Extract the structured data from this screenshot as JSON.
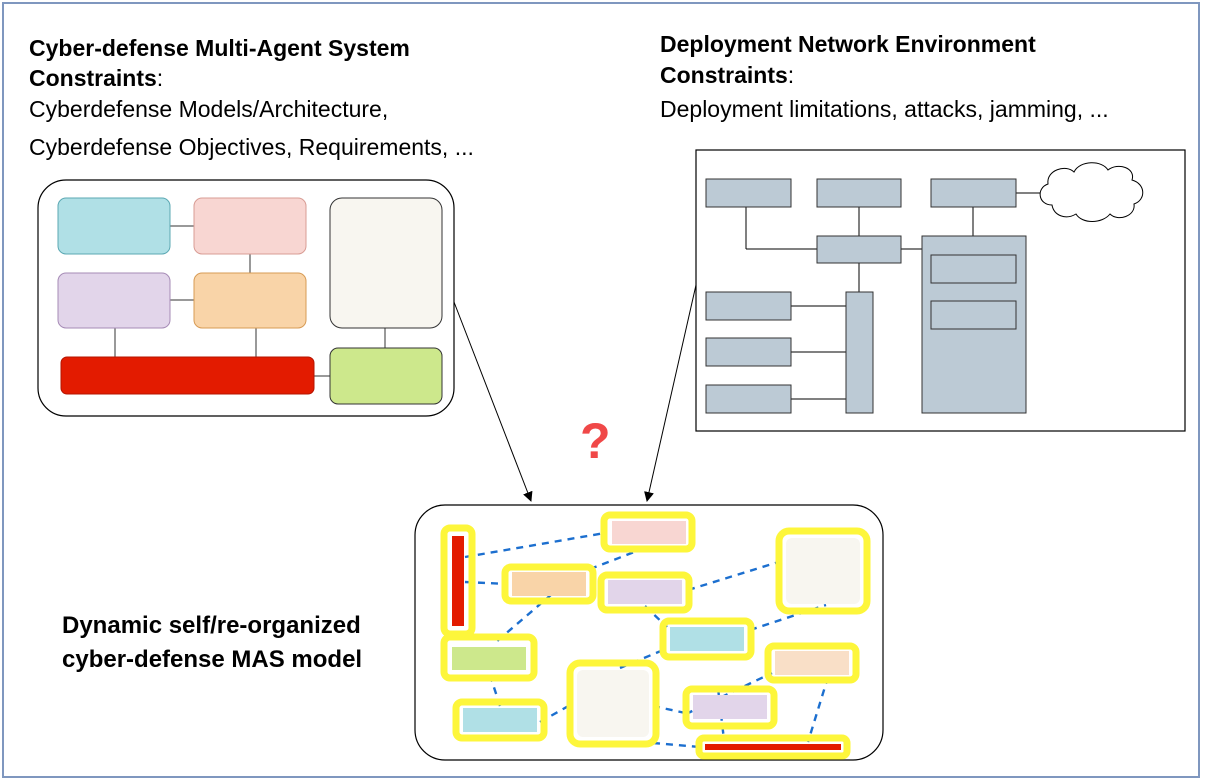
{
  "left_panel": {
    "title_line1": "Cyber-defense Multi-Agent System",
    "title_line2": "Constraints",
    "title_colon": ":",
    "body_line1": "Cyberdefense Models/Architecture,",
    "body_line2": "Cyberdefense Objectives, Requirements, ..."
  },
  "right_panel": {
    "title_line1": "Deployment Network Environment",
    "title_line2": "Constraints",
    "title_colon": ":",
    "body_line1": "Deployment limitations, attacks, jamming, ..."
  },
  "bottom_panel": {
    "label_line1": "Dynamic self/re-organized",
    "label_line2": "cyber-defense MAS model"
  },
  "question_mark": "?",
  "colors": {
    "frame_border": "#7f97bf",
    "teal": "#b0e0e6",
    "pink": "#f8d6d2",
    "lavender": "#e2d5ea",
    "peach": "#f9d4a8",
    "cream": "#f8f6f0",
    "red": "#e31b00",
    "green": "#cde88c",
    "network_box": "#bccad5",
    "highlight": "#fdf63b",
    "dashed_link": "#1c6fcf",
    "question": "#f04848"
  }
}
